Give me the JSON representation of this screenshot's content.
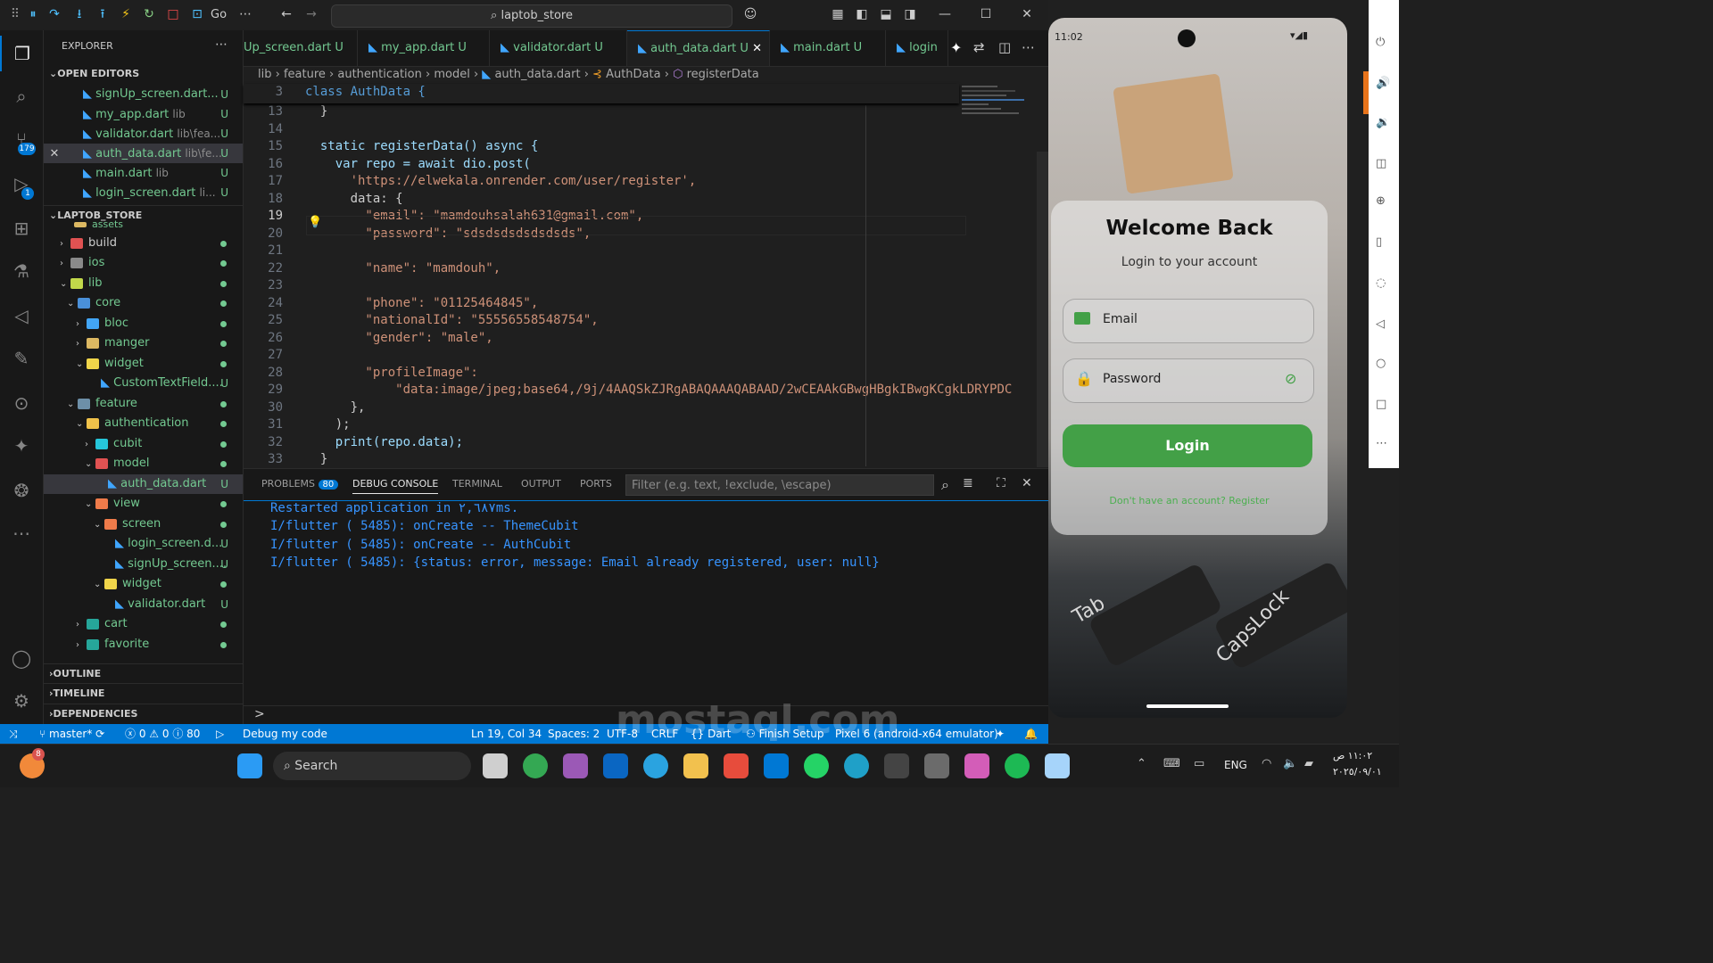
{
  "titlebar": {
    "search_text": "laptob_store",
    "partial_label": "Go"
  },
  "activity_bar": {
    "source_control_badge": "179",
    "run_badge": "1"
  },
  "explorer": {
    "title": "EXPLORER",
    "open_editors_header": "OPEN EDITORS",
    "project_header": "LAPTOB_STORE",
    "open_editors": [
      {
        "name": "signUp_screen.dart...",
        "status": "U"
      },
      {
        "name": "my_app.dart",
        "path": "lib",
        "status": "U"
      },
      {
        "name": "validator.dart",
        "path": "lib\\fea...",
        "status": "U"
      },
      {
        "name": "auth_data.dart",
        "path": "lib\\fe...",
        "status": "U"
      },
      {
        "name": "main.dart",
        "path": "lib",
        "status": "U"
      },
      {
        "name": "login_screen.dart",
        "path": "li...",
        "status": "U"
      }
    ],
    "tree": [
      {
        "name": "assets"
      },
      {
        "name": "build"
      },
      {
        "name": "ios"
      },
      {
        "name": "lib"
      },
      {
        "name": "core"
      },
      {
        "name": "bloc"
      },
      {
        "name": "manger"
      },
      {
        "name": "widget"
      },
      {
        "name": "CustomTextField....",
        "status": "U"
      },
      {
        "name": "feature"
      },
      {
        "name": "authentication"
      },
      {
        "name": "cubit"
      },
      {
        "name": "model"
      },
      {
        "name": "auth_data.dart",
        "status": "U"
      },
      {
        "name": "view"
      },
      {
        "name": "screen"
      },
      {
        "name": "login_screen.d...",
        "status": "U"
      },
      {
        "name": "signUp_screen....",
        "status": "U"
      },
      {
        "name": "widget"
      },
      {
        "name": "validator.dart",
        "status": "U"
      },
      {
        "name": "cart"
      },
      {
        "name": "favorite"
      }
    ],
    "outline": "OUTLINE",
    "timeline": "TIMELINE",
    "dependencies": "DEPENDENCIES"
  },
  "tabs": [
    {
      "label": "Up_screen.dart",
      "status": "U"
    },
    {
      "label": "my_app.dart",
      "status": "U"
    },
    {
      "label": "validator.dart",
      "status": "U"
    },
    {
      "label": "auth_data.dart",
      "status": "U"
    },
    {
      "label": "main.dart",
      "status": "U"
    },
    {
      "label": "login"
    }
  ],
  "breadcrumbs": [
    "lib",
    "feature",
    "authentication",
    "model",
    "auth_data.dart",
    "AuthData",
    "registerData"
  ],
  "code": {
    "sticky": {
      "num": "3",
      "text": "class AuthData {"
    },
    "lines": [
      {
        "num": "13",
        "text": "  }"
      },
      {
        "num": "14",
        "text": ""
      },
      {
        "num": "15",
        "text": "  static registerData() async {"
      },
      {
        "num": "16",
        "text": "    var repo = await dio.post("
      },
      {
        "num": "17",
        "text": "      'https://elwekala.onrender.com/user/register',"
      },
      {
        "num": "18",
        "text": "      data: {"
      },
      {
        "num": "19",
        "text": "        \"email\": \"mamdouhsalah631@gmail.com\","
      },
      {
        "num": "20",
        "text": "        \"password\": \"sdsdsdsdsdsdsds\","
      },
      {
        "num": "21",
        "text": ""
      },
      {
        "num": "22",
        "text": "        \"name\": \"mamdouh\","
      },
      {
        "num": "23",
        "text": ""
      },
      {
        "num": "24",
        "text": "        \"phone\": \"01125464845\","
      },
      {
        "num": "25",
        "text": "        \"nationalId\": \"55556558548754\","
      },
      {
        "num": "26",
        "text": "        \"gender\": \"male\","
      },
      {
        "num": "27",
        "text": ""
      },
      {
        "num": "28",
        "text": "        \"profileImage\":"
      },
      {
        "num": "29",
        "text": "            \"data:image/jpeg;base64,/9j/4AAQSkZJRgABAQAAAQABAAD/2wCEAAkGBwgHBgkIBwgKCgkLDRYPDC"
      },
      {
        "num": "30",
        "text": "      },"
      },
      {
        "num": "31",
        "text": "    );"
      },
      {
        "num": "32",
        "text": "    print(repo.data);"
      },
      {
        "num": "33",
        "text": "  }"
      }
    ]
  },
  "panel": {
    "tabs": [
      "PROBLEMS",
      "DEBUG CONSOLE",
      "TERMINAL",
      "OUTPUT",
      "PORTS"
    ],
    "problems_count": "80",
    "filter_placeholder": "Filter (e.g. text, !exclude, \\escape)",
    "console": [
      "Restarted application in ٢,٦٨٧ms.",
      "I/flutter ( 5485): onCreate -- ThemeCubit",
      "I/flutter ( 5485): onCreate -- AuthCubit",
      "I/flutter ( 5485): {status: error, message: Email already registered, user: null}"
    ],
    "prompt": ">"
  },
  "statusbar": {
    "branch": "master*",
    "errors": "0",
    "warnings": "0",
    "info": "80",
    "debug": "Debug my code",
    "position": "Ln 19, Col 34",
    "spaces": "Spaces: 2",
    "encoding": "UTF-8",
    "eol": "CRLF",
    "language": "Dart",
    "finish": "Finish Setup",
    "device": "Pixel 6 (android-x64 emulator)"
  },
  "phone": {
    "time": "11:02",
    "welcome": "Welcome Back",
    "subtitle": "Login to your account",
    "email_label": "Email",
    "password_label": "Password",
    "login_button": "Login",
    "register_link": "Don't have an account? Register",
    "key_tab": "Tab",
    "key_caps": "CapsLock"
  },
  "taskbar": {
    "search": "Search",
    "lang": "ENG",
    "time": "١١:٠٢ ص",
    "date": "٢٠٢٥/٠٩/٠١",
    "notif_count": "8"
  },
  "watermark": "mostaql.com",
  "colors": {
    "accent": "#0078d4",
    "login_green": "#43a047",
    "modified": "#73c991"
  }
}
